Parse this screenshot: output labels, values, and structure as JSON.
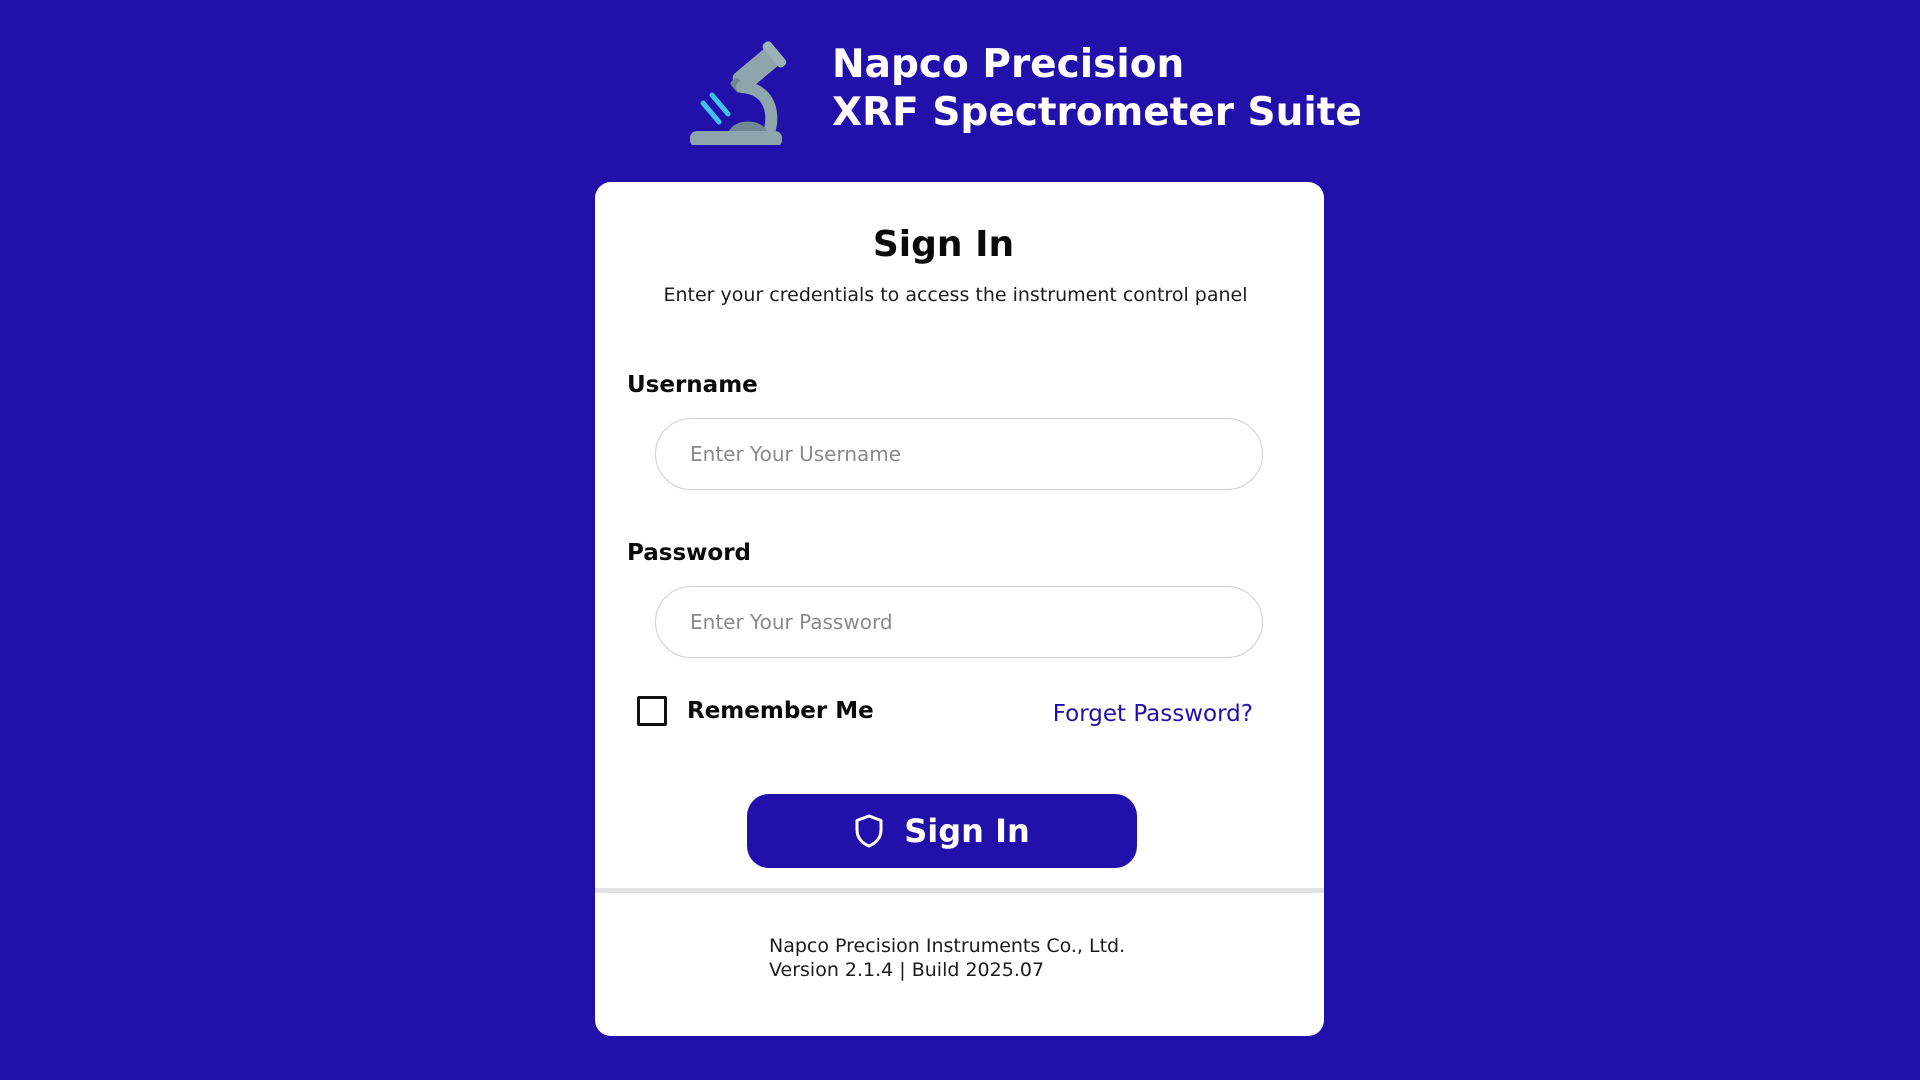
{
  "header": {
    "title_line1": "Napco Precision",
    "title_line2": "XRF Spectrometer Suite",
    "logo_icon": "microscope-icon"
  },
  "login": {
    "heading": "Sign In",
    "subtitle": "Enter your credentials to access the instrument control panel",
    "username_label": "Username",
    "username_placeholder": "Enter Your Username",
    "username_value": "",
    "password_label": "Password",
    "password_placeholder": "Enter Your Password",
    "password_value": "",
    "remember_label": "Remember Me",
    "remember_checked": false,
    "forgot_label": "Forget Password?",
    "submit_label": "Sign In",
    "submit_icon": "shield-icon"
  },
  "footer": {
    "company": "Napco Precision Instruments Co., Ltd.",
    "version": "Version 2.1.4 | Build 2025.07"
  },
  "colors": {
    "background": "#2110a9",
    "card": "#ffffff",
    "accent": "#2110a9",
    "logo_primary": "#8fa5ad",
    "logo_accent": "#3fc2ee"
  }
}
